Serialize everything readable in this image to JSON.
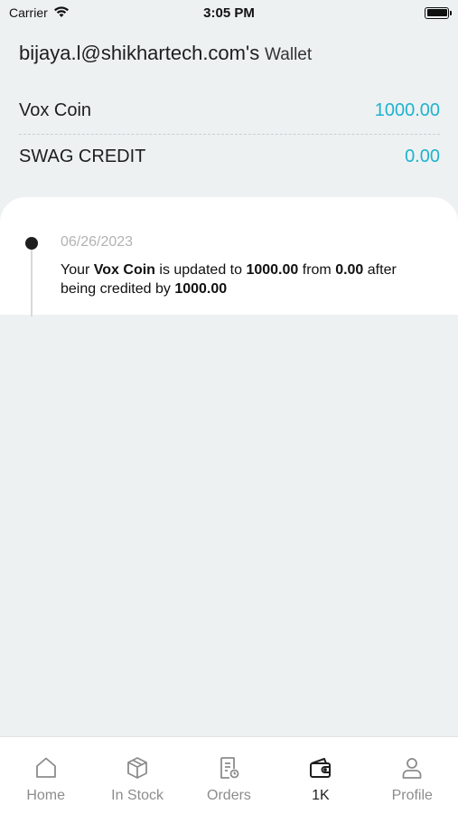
{
  "status_bar": {
    "carrier": "Carrier",
    "time": "3:05 PM"
  },
  "wallet": {
    "owner": "bijaya.l@shikhartech.com's",
    "title_suffix": "Wallet",
    "balances": [
      {
        "label": "Vox Coin",
        "value": "1000.00"
      },
      {
        "label": "SWAG CREDIT",
        "value": "0.00"
      }
    ]
  },
  "history": [
    {
      "date": "06/26/2023",
      "t1": "Your ",
      "coin": "Vox Coin",
      "t2": " is updated to ",
      "new_value": "1000.00",
      "t3": " from ",
      "old_value": "0.00",
      "t4": " after being credited by ",
      "amount": "1000.00"
    }
  ],
  "nav": {
    "items": [
      {
        "label": "Home",
        "icon": "home-icon"
      },
      {
        "label": "In Stock",
        "icon": "box-icon"
      },
      {
        "label": "Orders",
        "icon": "orders-icon"
      },
      {
        "label": "1K",
        "icon": "wallet-icon",
        "active": true
      },
      {
        "label": "Profile",
        "icon": "profile-icon"
      }
    ]
  },
  "colors": {
    "accent": "#1fb3cf",
    "background": "#edf1f2",
    "inactive_nav": "#8c8c8c"
  }
}
